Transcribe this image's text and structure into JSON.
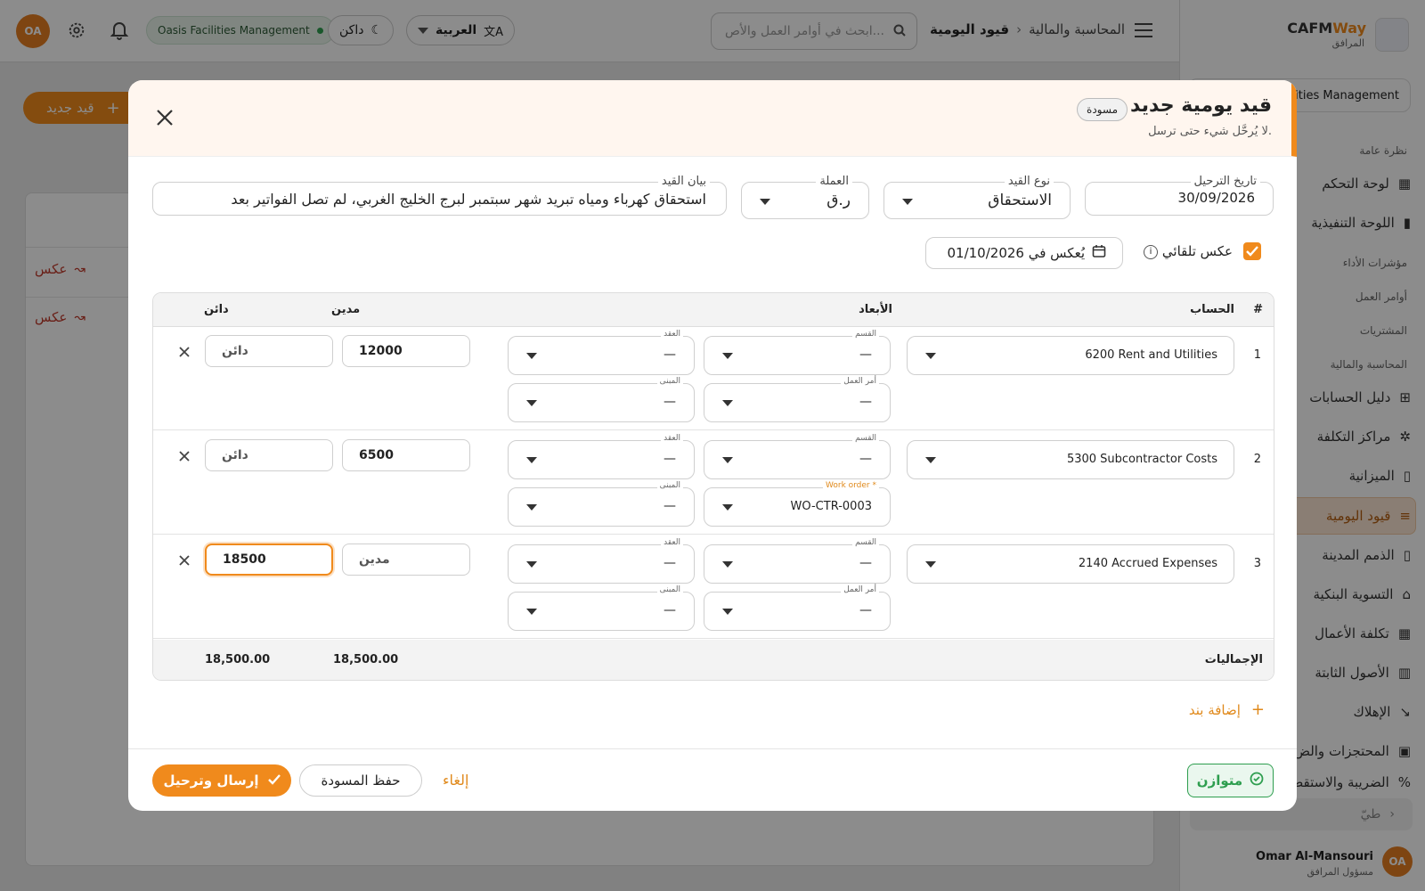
{
  "topbar": {
    "avatar": "OA",
    "org_badge": "Oasis Facilities Management",
    "theme_label": "داكن",
    "language_label": "العربية",
    "search_placeholder": "ابحث في أوامر العمل والأص...",
    "breadcrumb_parent": "المحاسبة والمالية",
    "breadcrumb_current": "قيود اليومية"
  },
  "brand": {
    "name_a": "CAFM",
    "name_b": "Way",
    "subtitle": "المرافق"
  },
  "sidebar": {
    "org": "Facilities Management",
    "sections": {
      "overview": "نظرة عامة",
      "kpi": "مؤشرات الأداء",
      "work_orders": "أوامر العمل",
      "procurement": "المشتريات",
      "finance": "المحاسبة والمالية"
    },
    "items": [
      {
        "label": "لوحة التحكم",
        "icon": "dashboard-icon"
      },
      {
        "label": "اللوحة التنفيذية",
        "icon": "bar-chart-icon"
      },
      {
        "label": "دليل الحسابات",
        "icon": "tree-icon"
      },
      {
        "label": "مراكز التكلفة",
        "icon": "nodes-icon"
      },
      {
        "label": "الميزانية",
        "icon": "document-dollar-icon"
      },
      {
        "label": "قيود اليومية",
        "icon": "journal-icon"
      },
      {
        "label": "الذمم المدينة",
        "icon": "receivable-icon"
      },
      {
        "label": "التسوية البنكية",
        "icon": "bank-icon"
      },
      {
        "label": "تكلفة الأعمال",
        "icon": "calculator-icon"
      },
      {
        "label": "الأصول الثابتة",
        "icon": "building-icon"
      },
      {
        "label": "الإهلاك",
        "icon": "trend-down-icon"
      },
      {
        "label": "المحتجزات والض",
        "icon": "lock-dollar-icon"
      },
      {
        "label": "الضريبة والاستقط",
        "icon": "tax-icon"
      }
    ],
    "collapse_label": "طيّ",
    "user_name": "Omar Al-Mansouri",
    "user_role": "مسؤول المرافق",
    "user_initials": "OA"
  },
  "page": {
    "new_entry_button": "قيد جديد",
    "reverse_label": "عكس"
  },
  "modal": {
    "title": "قيد يومية جديد",
    "status_badge": "مسودة",
    "subtitle": "لا يُرحَّل شيء حتى ترسل.",
    "posting_date_label": "تاريخ الترحيل",
    "posting_date": "30/09/2026",
    "entry_type_label": "نوع القيد",
    "entry_type": "الاستحقاق",
    "currency_label": "العملة",
    "currency": "ر.ق",
    "memo_label": "بيان القيد",
    "memo": "استحقاق كهرباء ومياه تبريد شهر سبتمبر لبرج الخليج الغربي، لم تصل الفواتير بعد",
    "auto_reverse_label": "عكس تلقائي",
    "reverse_on": "يُعكس في 01/10/2026",
    "table": {
      "headers": {
        "num": "#",
        "account": "الحساب",
        "dimensions": "الأبعاد",
        "debit": "مدين",
        "credit": "دائن"
      },
      "dim_labels": {
        "division": "القسم",
        "contract": "العقد",
        "work_order": "أمر العمل",
        "building": "المبنى",
        "work_order_required": "Work order *"
      },
      "rows": [
        {
          "num": "1",
          "account": "6200  Rent and Utilities",
          "division": "—",
          "contract": "—",
          "work_order": "—",
          "building": "—",
          "debit": "12000",
          "credit": "دائن"
        },
        {
          "num": "2",
          "account": "5300  Subcontractor Costs",
          "division": "—",
          "contract": "—",
          "work_order": "WO-CTR-0003",
          "building": "—",
          "debit": "6500",
          "credit": "دائن"
        },
        {
          "num": "3",
          "account": "2140  Accrued Expenses",
          "division": "—",
          "contract": "—",
          "work_order": "—",
          "building": "—",
          "debit": "مدين",
          "credit": "18500"
        }
      ],
      "totals_label": "الإجماليات",
      "total_debit": "18,500.00",
      "total_credit": "18,500.00"
    },
    "add_line": "إضافة بند",
    "balanced": "متوازن",
    "cancel": "إلغاء",
    "save_draft": "حفظ المسودة",
    "submit": "إرسال وترحيل"
  },
  "colors": {
    "accent": "#f08a1c",
    "success": "#2e9e4f",
    "danger": "#c0392b"
  }
}
